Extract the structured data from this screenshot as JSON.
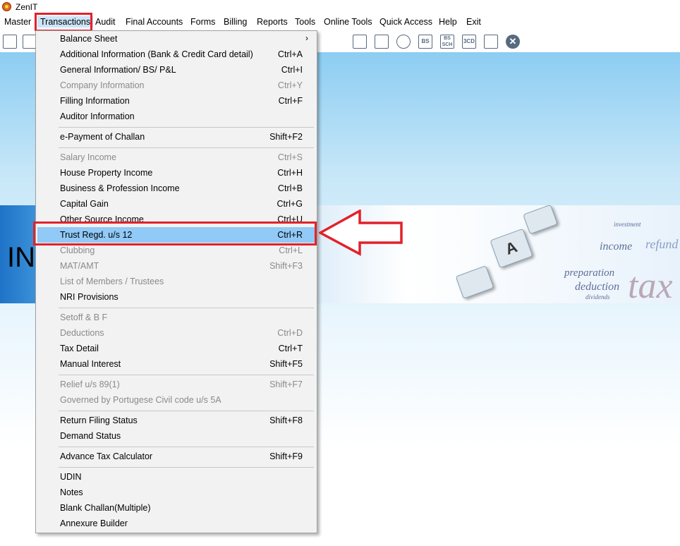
{
  "app": {
    "title": "ZenIT"
  },
  "menubar": {
    "items": [
      {
        "label": "Master"
      },
      {
        "label": "Transactions"
      },
      {
        "label": "Audit"
      },
      {
        "label": "Final Accounts"
      },
      {
        "label": "Forms"
      },
      {
        "label": "Billing"
      },
      {
        "label": "Reports"
      },
      {
        "label": "Tools"
      },
      {
        "label": "Online Tools"
      },
      {
        "label": "Quick Access"
      },
      {
        "label": "Help"
      },
      {
        "label": "Exit"
      }
    ],
    "active": "Transactions"
  },
  "toolbar": {
    "icons": [
      "report-icon",
      "home-icon",
      "bs-icon",
      "bs-sch-icon",
      "3cd-icon",
      "grid-icon",
      "close-icon"
    ],
    "bs_label": "BS",
    "bs_sch_label": "BS SCH",
    "cd3_label": "3CD"
  },
  "banner": {
    "text": "INC"
  },
  "menu": {
    "items": [
      {
        "label": "Balance Sheet",
        "shortcut": "",
        "submenu": true
      },
      {
        "label": "Additional Information (Bank & Credit Card detail)",
        "shortcut": "Ctrl+A"
      },
      {
        "label": "General Information/ BS/ P&L",
        "shortcut": "Ctrl+I"
      },
      {
        "label": "Company Information",
        "shortcut": "Ctrl+Y",
        "disabled": true
      },
      {
        "label": "Filling Information",
        "shortcut": "Ctrl+F"
      },
      {
        "label": "Auditor Information",
        "shortcut": ""
      },
      {
        "label": "e-Payment of Challan",
        "shortcut": "Shift+F2"
      },
      {
        "label": "Salary Income",
        "shortcut": "Ctrl+S",
        "disabled": true
      },
      {
        "label": "House Property Income",
        "shortcut": "Ctrl+H"
      },
      {
        "label": "Business & Profession Income",
        "shortcut": "Ctrl+B"
      },
      {
        "label": "Capital Gain",
        "shortcut": "Ctrl+G"
      },
      {
        "label": "Other Source Income",
        "shortcut": "Ctrl+U"
      },
      {
        "label": "Trust Regd. u/s 12",
        "shortcut": "Ctrl+R",
        "selected": true
      },
      {
        "label": "Clubbing",
        "shortcut": "Ctrl+L",
        "disabled": true
      },
      {
        "label": "MAT/AMT",
        "shortcut": "Shift+F3",
        "disabled": true
      },
      {
        "label": "List of Members / Trustees",
        "shortcut": "",
        "disabled": true
      },
      {
        "label": "NRI Provisions",
        "shortcut": ""
      },
      {
        "label": "Setoff & B F",
        "shortcut": "",
        "disabled": true
      },
      {
        "label": "Deductions",
        "shortcut": "Ctrl+D",
        "disabled": true
      },
      {
        "label": "Tax Detail",
        "shortcut": "Ctrl+T"
      },
      {
        "label": "Manual Interest",
        "shortcut": "Shift+F5"
      },
      {
        "label": "Relief u/s 89(1)",
        "shortcut": "Shift+F7",
        "disabled": true
      },
      {
        "label": "Governed by Portugese Civil code u/s 5A",
        "shortcut": "",
        "disabled": true
      },
      {
        "label": "Return Filing Status",
        "shortcut": "Shift+F8"
      },
      {
        "label": "Demand Status",
        "shortcut": ""
      },
      {
        "label": "Advance Tax Calculator",
        "shortcut": "Shift+F9"
      },
      {
        "label": "UDIN",
        "shortcut": ""
      },
      {
        "label": "Notes",
        "shortcut": ""
      },
      {
        "label": "Blank Challan(Multiple)",
        "shortcut": ""
      },
      {
        "label": "Annexure Builder",
        "shortcut": ""
      }
    ]
  },
  "colors": {
    "highlight": "#e3212a",
    "selected_bg": "#91c9f7",
    "disabled_text": "#8a8a8a"
  }
}
